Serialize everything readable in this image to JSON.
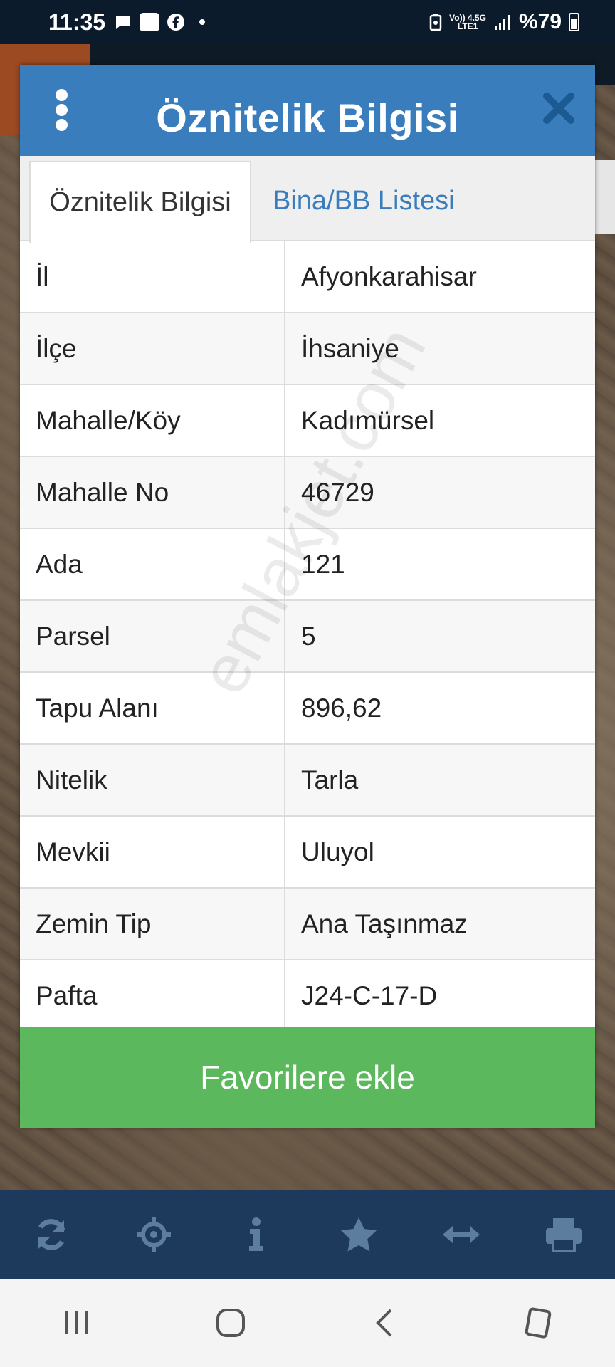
{
  "status_bar": {
    "time": "11:35",
    "network_top": "Vo)) 4.5G",
    "network_bottom": "LTE1",
    "battery": "%79"
  },
  "dialog": {
    "title": "Öznitelik Bilgisi",
    "menu_icon": "kebab-menu-icon",
    "close_icon": "close-icon",
    "tabs": [
      {
        "label": "Öznitelik Bilgisi",
        "active": true
      },
      {
        "label": "Bina/BB Listesi",
        "active": false
      }
    ],
    "rows": [
      {
        "key": "İl",
        "value": "Afyonkarahisar"
      },
      {
        "key": "İlçe",
        "value": "İhsaniye"
      },
      {
        "key": "Mahalle/Köy",
        "value": "Kadımürsel"
      },
      {
        "key": "Mahalle No",
        "value": "46729"
      },
      {
        "key": "Ada",
        "value": "121"
      },
      {
        "key": "Parsel",
        "value": "5"
      },
      {
        "key": "Tapu Alanı",
        "value": "896,62"
      },
      {
        "key": "Nitelik",
        "value": "Tarla"
      },
      {
        "key": "Mevkii",
        "value": "Uluyol"
      },
      {
        "key": "Zemin Tip",
        "value": "Ana Taşınmaz"
      },
      {
        "key": "Pafta",
        "value": "J24-C-17-D"
      }
    ],
    "watermark": "emlakjet.com",
    "favorite_button": "Favorilere ekle"
  },
  "toolbar": {
    "icons": [
      "refresh-icon",
      "locate-icon",
      "info-icon",
      "star-icon",
      "measure-icon",
      "print-icon"
    ]
  },
  "colors": {
    "header_blue": "#3a7dbd",
    "tab_link_blue": "#3a7dbd",
    "button_green": "#5cb85c",
    "toolbar_navy": "#1d3a5c"
  }
}
